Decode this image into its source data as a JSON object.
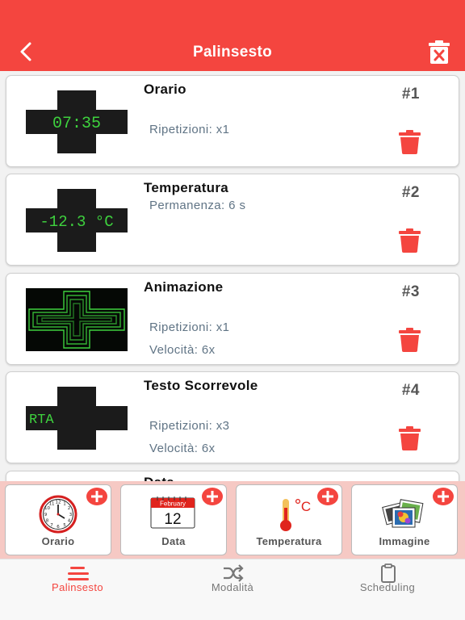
{
  "header": {
    "title": "Palinsesto"
  },
  "items": [
    {
      "name": "Orario",
      "number": "#1",
      "thumb_text": "07:35",
      "details": [
        "Ripetizioni: x1"
      ]
    },
    {
      "name": "Temperatura",
      "number": "#2",
      "thumb_text": "-12.3 °C",
      "details": [
        "Permanenza: 6 s"
      ]
    },
    {
      "name": "Animazione",
      "number": "#3",
      "details": [
        "Ripetizioni: x1",
        "Velocità: 6x"
      ]
    },
    {
      "name": "Testo Scorrevole",
      "number": "#4",
      "thumb_text": "RTA",
      "details": [
        "Ripetizioni: x3",
        "Velocità: 6x"
      ]
    },
    {
      "name": "Data"
    }
  ],
  "add_buttons": [
    {
      "label": "Orario",
      "icon": "clock-icon"
    },
    {
      "label": "Data",
      "icon": "calendar-icon",
      "calendar_month": "February",
      "calendar_day": "12"
    },
    {
      "label": "Temperatura",
      "icon": "thermometer-icon",
      "unit": "C"
    },
    {
      "label": "Immagine",
      "icon": "image-icon"
    }
  ],
  "tabs": [
    {
      "label": "Palinsesto",
      "icon": "menu-icon",
      "active": true
    },
    {
      "label": "Modalità",
      "icon": "shuffle-icon",
      "active": false
    },
    {
      "label": "Scheduling",
      "icon": "clipboard-icon",
      "active": false
    }
  ],
  "colors": {
    "accent": "#f4453f",
    "led_green": "#3ed13e",
    "add_bar": "#f6c9c4"
  }
}
